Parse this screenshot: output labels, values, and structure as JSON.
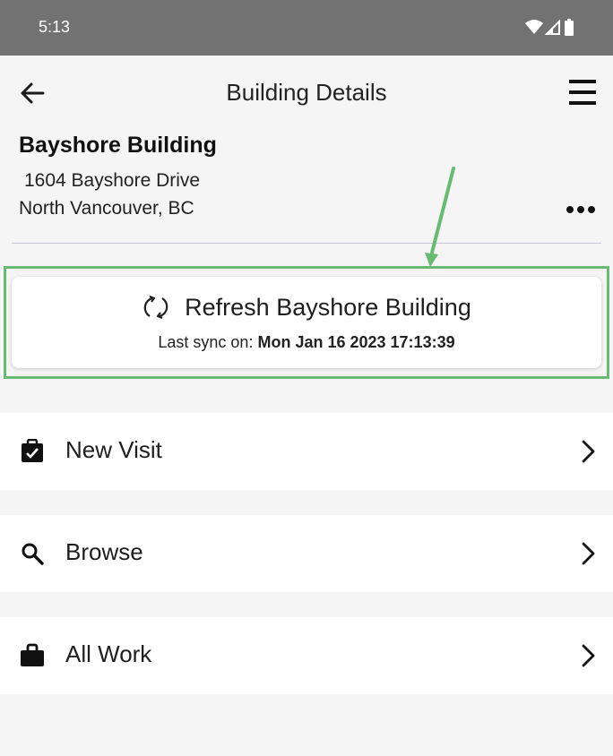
{
  "status_bar": {
    "time": "5:13",
    "icons": [
      "wifi-icon",
      "signal-icon",
      "battery-icon"
    ]
  },
  "header": {
    "title": "Building Details",
    "back_icon": "arrow-left-icon",
    "menu_icon": "hamburger-menu-icon"
  },
  "building": {
    "name": "Bayshore Building",
    "address_line1": "1604 Bayshore Drive",
    "address_line2": "North Vancouver, BC",
    "more_icon": "more-horizontal-icon"
  },
  "refresh": {
    "label": "Refresh Bayshore Building",
    "sync_prefix": "Last sync on:",
    "sync_value": "Mon Jan 16 2023 17:13:39",
    "icon": "sync-icon"
  },
  "nav": [
    {
      "label": "New Visit",
      "icon": "clipboard-check-icon"
    },
    {
      "label": "Browse",
      "icon": "search-icon"
    },
    {
      "label": "All Work",
      "icon": "briefcase-icon"
    }
  ],
  "colors": {
    "status_bar": "#727272",
    "background": "#f5f5f5",
    "annotation_green": "#69bb74"
  }
}
